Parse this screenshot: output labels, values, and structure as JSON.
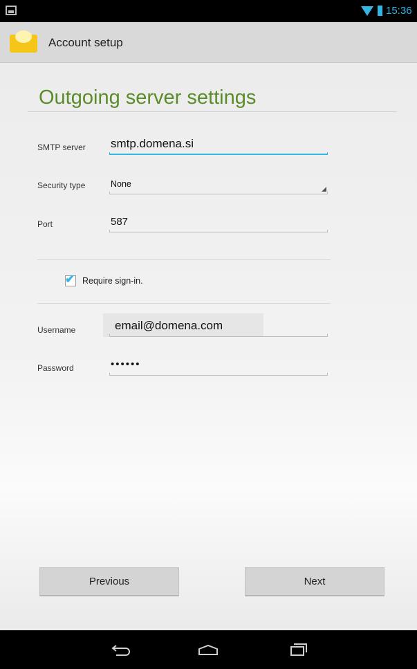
{
  "status_bar": {
    "time": "15:36"
  },
  "action_bar": {
    "title": "Account setup",
    "icon": "email-envelope-icon"
  },
  "page": {
    "heading": "Outgoing server settings"
  },
  "form": {
    "smtp_label": "SMTP server",
    "smtp_value": "smtp.domena.si",
    "security_label": "Security type",
    "security_value": "None",
    "port_label": "Port",
    "port_value": "587",
    "require_signin_label": "Require sign-in.",
    "require_signin_checked": true,
    "username_label": "Username",
    "username_value": "email@domena.com",
    "password_label": "Password",
    "password_value": "••••••"
  },
  "buttons": {
    "previous": "Previous",
    "next": "Next"
  },
  "nav_bar": {
    "icons": [
      "back-icon",
      "home-icon",
      "recent-apps-icon"
    ]
  },
  "colors": {
    "accent": "#33b5e5",
    "heading": "#5b8c2a"
  }
}
